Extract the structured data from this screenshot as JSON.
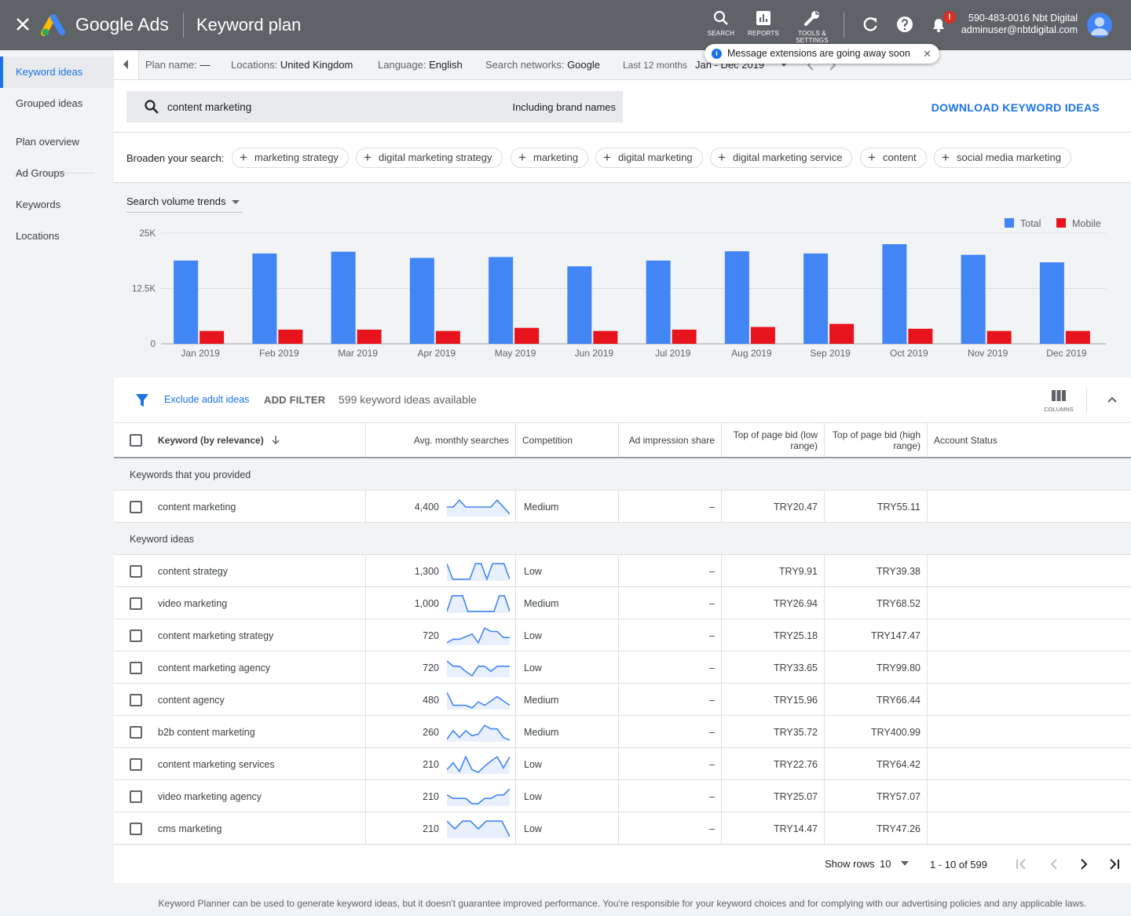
{
  "app": {
    "brand": "Google Ads",
    "page_title": "Keyword plan"
  },
  "topbar": {
    "search_label": "SEARCH",
    "reports_label": "REPORTS",
    "tools_label_1": "TOOLS &",
    "tools_label_2": "SETTINGS",
    "notification_badge": "!",
    "account_line1": "590-483-0016 Nbt Digital",
    "account_line2": "adminuser@nbtdigital.com"
  },
  "sidebar": {
    "items": [
      {
        "label": "Keyword ideas"
      },
      {
        "label": "Grouped ideas"
      },
      {
        "label": "Plan overview"
      },
      {
        "label": "Ad Groups"
      },
      {
        "label": "Keywords"
      },
      {
        "label": "Locations"
      }
    ]
  },
  "infobar": {
    "plan_label": "Plan name:",
    "plan_value": "—",
    "loc_label": "Locations:",
    "loc_value": "United Kingdom",
    "lang_label": "Language:",
    "lang_value": "English",
    "net_label": "Search networks:",
    "net_value": "Google",
    "period_label": "Last 12 months",
    "period_value": "Jan - Dec 2019"
  },
  "toast": {
    "text": "Message extensions are going away soon"
  },
  "search": {
    "query": "content marketing",
    "brand_toggle": "Including brand names",
    "download_label": "DOWNLOAD KEYWORD IDEAS",
    "broaden_label": "Broaden your search:",
    "chips": [
      "marketing strategy",
      "digital marketing strategy",
      "marketing",
      "digital marketing",
      "digital marketing service",
      "content",
      "social media marketing"
    ]
  },
  "trend": {
    "selector_label": "Search volume trends"
  },
  "chart_data": {
    "type": "bar",
    "categories": [
      "Jan 2019",
      "Feb 2019",
      "Mar 2019",
      "Apr 2019",
      "May 2019",
      "Jun 2019",
      "Jul 2019",
      "Aug 2019",
      "Sep 2019",
      "Oct 2019",
      "Nov 2019",
      "Dec 2019"
    ],
    "series": [
      {
        "name": "Total",
        "color": "#4285f4",
        "values": [
          18800,
          20400,
          20800,
          19400,
          19600,
          17500,
          18800,
          20900,
          20400,
          22500,
          20100,
          18400
        ]
      },
      {
        "name": "Mobile",
        "color": "#e8141d",
        "values": [
          2900,
          3200,
          3200,
          2900,
          3600,
          2900,
          3200,
          3800,
          4500,
          3400,
          2900,
          2900
        ]
      }
    ],
    "ylim": [
      0,
      25000
    ],
    "yticks": [
      "0",
      "12.5K",
      "25K"
    ],
    "grid": true,
    "legend": "top-right"
  },
  "filterbar": {
    "exclude_label": "Exclude adult ideas",
    "add_filter": "ADD FILTER",
    "available": "599 keyword ideas available",
    "columns_label": "COLUMNS"
  },
  "table": {
    "headers": {
      "keyword": "Keyword (by relevance)",
      "avg": "Avg. monthly searches",
      "competition": "Competition",
      "impression": "Ad impression share",
      "low_bid_1": "Top of page bid (low",
      "low_bid_2": "range)",
      "high_bid_1": "Top of page bid (high",
      "high_bid_2": "range)",
      "status": "Account Status"
    },
    "group_provided": "Keywords that you provided",
    "group_ideas": "Keyword ideas",
    "provided": [
      {
        "keyword": "content marketing",
        "searches": "4,400",
        "competition": "Medium",
        "impression": "–",
        "low": "TRY20.47",
        "high": "TRY55.11",
        "trend": [
          0.5,
          0.5,
          0.9,
          0.5,
          0.5,
          0.5,
          0.5,
          0.5,
          0.9,
          0.5,
          0.1
        ]
      }
    ],
    "ideas": [
      {
        "keyword": "content strategy",
        "searches": "1,300",
        "competition": "Low",
        "impression": "–",
        "low": "TRY9.91",
        "high": "TRY39.38",
        "trend": [
          0.95,
          0.05,
          0.05,
          0.05,
          0.05,
          0.95,
          0.95,
          0.05,
          0.95,
          0.95,
          0.95,
          0.05
        ]
      },
      {
        "keyword": "video marketing",
        "searches": "1,000",
        "competition": "Medium",
        "impression": "–",
        "low": "TRY26.94",
        "high": "TRY68.52",
        "trend": [
          0.05,
          0.95,
          0.95,
          0.95,
          0.05,
          0.05,
          0.05,
          0.05,
          0.05,
          0.05,
          0.95,
          0.95,
          0.05
        ]
      },
      {
        "keyword": "content marketing strategy",
        "searches": "720",
        "competition": "Low",
        "impression": "–",
        "low": "TRY25.18",
        "high": "TRY147.47",
        "trend": [
          0.1,
          0.3,
          0.3,
          0.45,
          0.6,
          0.1,
          0.95,
          0.75,
          0.75,
          0.4,
          0.4
        ]
      },
      {
        "keyword": "content marketing agency",
        "searches": "720",
        "competition": "Low",
        "impression": "–",
        "low": "TRY33.65",
        "high": "TRY99.80",
        "trend": [
          0.9,
          0.6,
          0.6,
          0.3,
          0.05,
          0.6,
          0.6,
          0.3,
          0.6,
          0.6,
          0.6
        ]
      },
      {
        "keyword": "content agency",
        "searches": "480",
        "competition": "Medium",
        "impression": "–",
        "low": "TRY15.96",
        "high": "TRY66.44",
        "trend": [
          0.95,
          0.2,
          0.2,
          0.2,
          0.05,
          0.4,
          0.2,
          0.45,
          0.7,
          0.45,
          0.2
        ]
      },
      {
        "keyword": "b2b content marketing",
        "searches": "260",
        "competition": "Medium",
        "impression": "–",
        "low": "TRY35.72",
        "high": "TRY400.99",
        "trend": [
          0.1,
          0.6,
          0.2,
          0.6,
          0.3,
          0.4,
          0.9,
          0.7,
          0.7,
          0.2,
          0.05
        ]
      },
      {
        "keyword": "content marketing services",
        "searches": "210",
        "competition": "Low",
        "impression": "–",
        "low": "TRY22.76",
        "high": "TRY64.42",
        "trend": [
          0.2,
          0.6,
          0.1,
          0.95,
          0.2,
          0.05,
          0.4,
          0.7,
          0.95,
          0.3,
          0.95
        ]
      },
      {
        "keyword": "video marketing agency",
        "searches": "210",
        "competition": "Low",
        "impression": "–",
        "low": "TRY25.07",
        "high": "TRY57.07",
        "trend": [
          0.6,
          0.4,
          0.4,
          0.4,
          0.1,
          0.1,
          0.4,
          0.4,
          0.6,
          0.6,
          0.95
        ]
      },
      {
        "keyword": "cms marketing",
        "searches": "210",
        "competition": "Low",
        "impression": "–",
        "low": "TRY14.47",
        "high": "TRY47.26",
        "trend": [
          0.95,
          0.5,
          0.95,
          0.95,
          0.5,
          0.95,
          0.95,
          0.95,
          0.05
        ]
      }
    ]
  },
  "pager": {
    "show_rows_label": "Show rows",
    "rows_value": "10",
    "range": "1 - 10 of 599"
  },
  "footer": {
    "text": "Keyword Planner can be used to generate keyword ideas, but it doesn't guarantee improved performance. You're responsible for your keyword choices and for complying with our advertising policies and any applicable laws."
  },
  "colors": {
    "accent": "#1a73e8",
    "total": "#4285f4",
    "mobile": "#e8141d",
    "topbar": "#5f6368"
  }
}
